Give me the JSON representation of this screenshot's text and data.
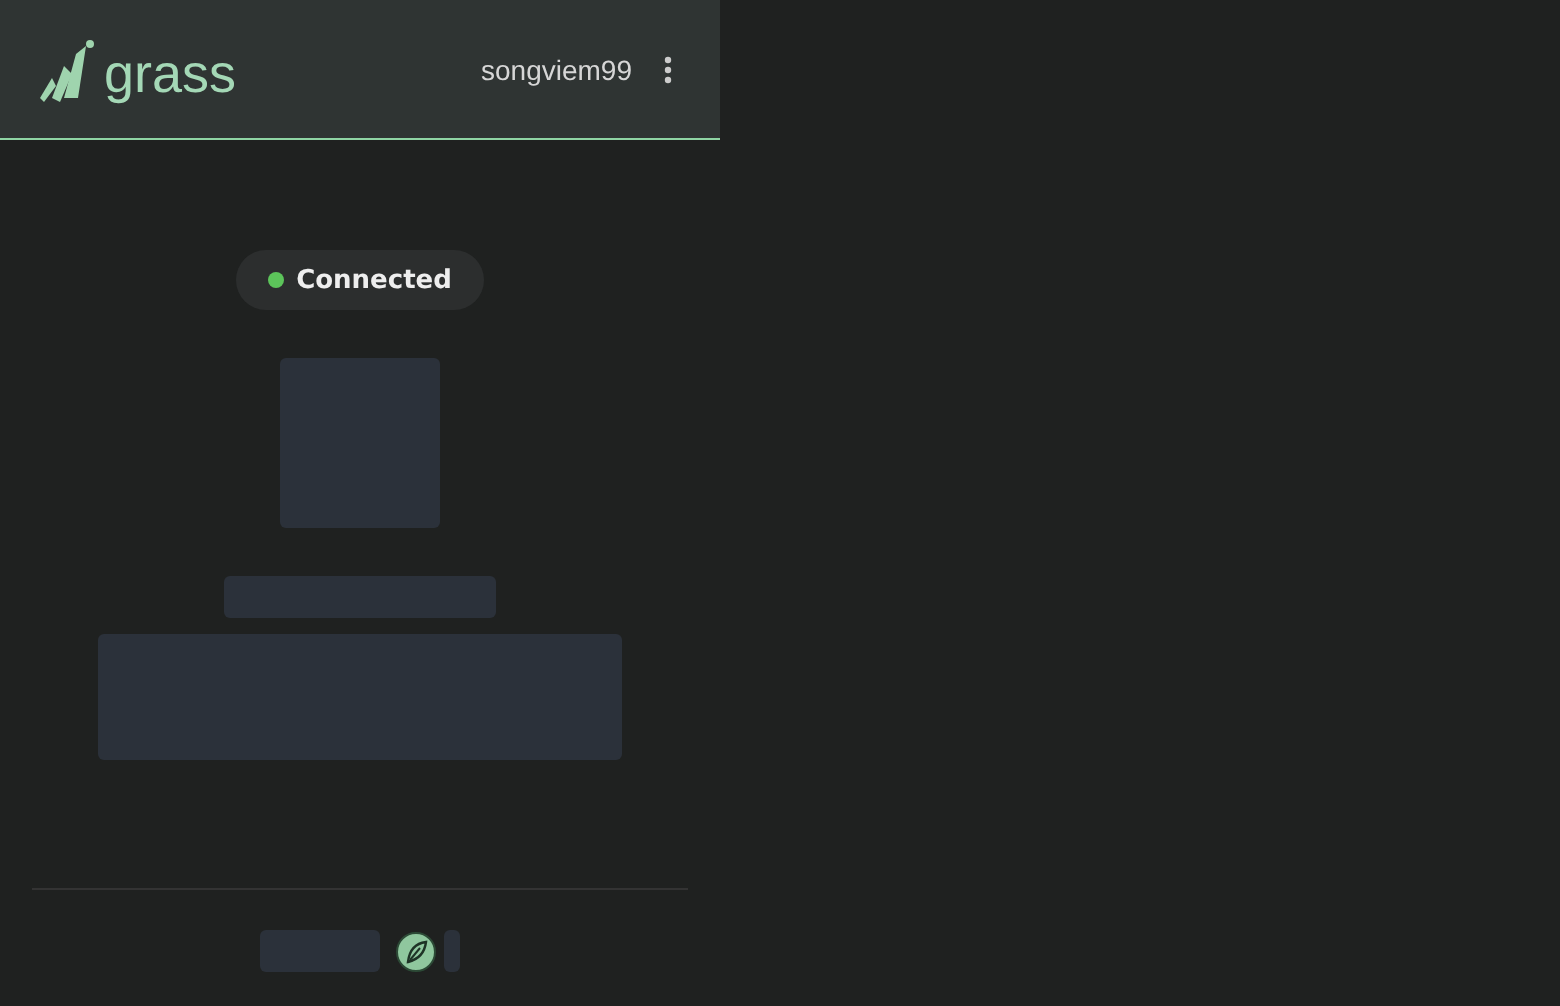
{
  "header": {
    "logo_text": "grass",
    "username": "songviem99"
  },
  "status": {
    "label": "Connected",
    "connected": true
  }
}
